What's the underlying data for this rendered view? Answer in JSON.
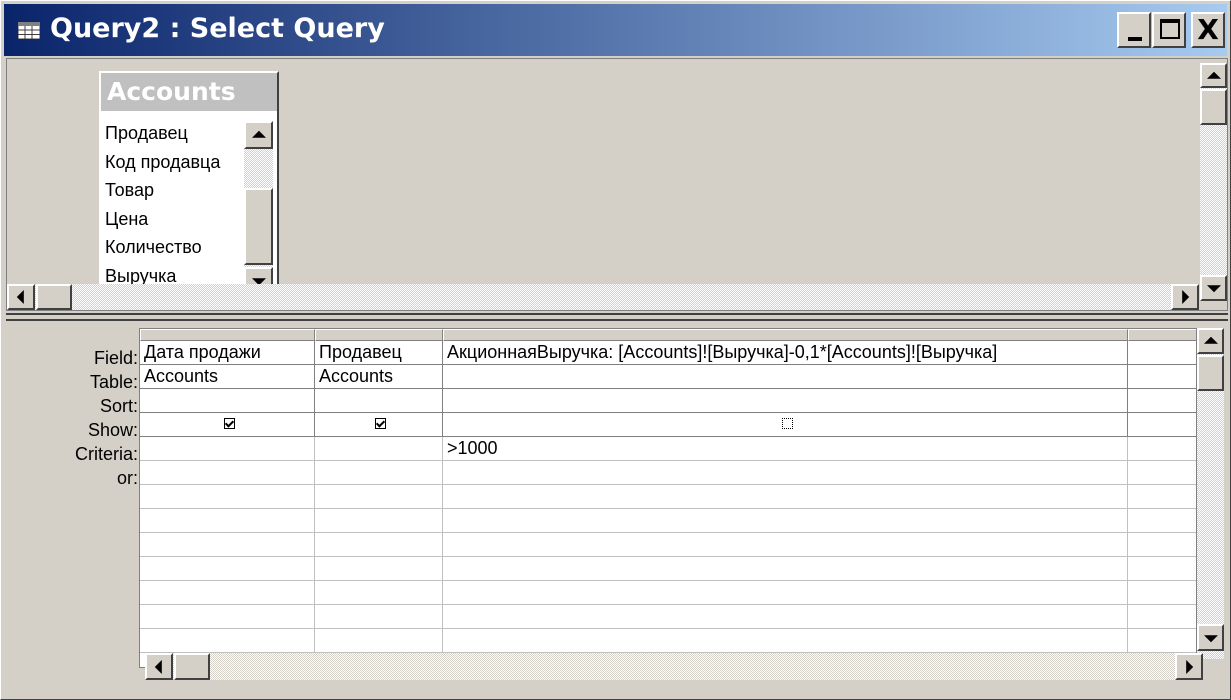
{
  "window": {
    "title": "Query2 : Select Query",
    "icon": "query-icon",
    "caption_buttons": {
      "minimize": "_",
      "maximize": "□",
      "close": "X"
    }
  },
  "field_list": {
    "title": "Accounts",
    "items": [
      {
        "label": "Продавец"
      },
      {
        "label": "Код продавца"
      },
      {
        "label": "Товар"
      },
      {
        "label": "Цена"
      },
      {
        "label": "Количество"
      },
      {
        "label": "Выручка"
      }
    ]
  },
  "grid": {
    "row_labels": [
      "Field:",
      "Table:",
      "Sort:",
      "Show:",
      "Criteria:",
      "or:"
    ],
    "columns": [
      {
        "field": "Дата продажи",
        "table": "Accounts",
        "sort": "",
        "show": true,
        "criteria": "",
        "or": ""
      },
      {
        "field": "Продавец",
        "table": "Accounts",
        "sort": "",
        "show": true,
        "criteria": "",
        "or": ""
      },
      {
        "field": "АкционнаяВыручка: [Accounts]![Выручка]-0,1*[Accounts]![Выручка]",
        "table": "",
        "sort": "",
        "show": false,
        "criteria": ">1000",
        "or": ""
      },
      {
        "field": "",
        "table": "",
        "sort": "",
        "show": null,
        "criteria": "",
        "or": ""
      }
    ]
  }
}
